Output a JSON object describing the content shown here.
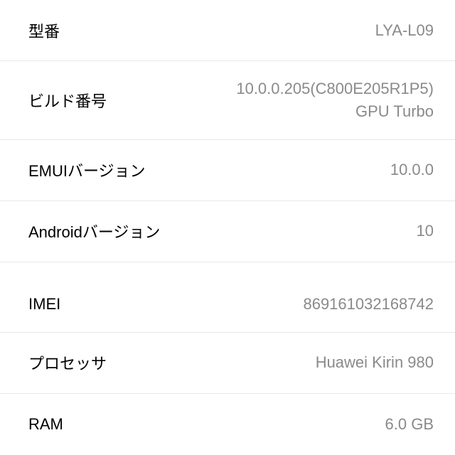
{
  "rows": [
    {
      "label": "型番",
      "value": "LYA-L09"
    },
    {
      "label": "ビルド番号",
      "value": "10.0.0.205(C800E205R1P5)\nGPU Turbo"
    },
    {
      "label": "EMUIバージョン",
      "value": "10.0.0"
    },
    {
      "label": "Androidバージョン",
      "value": "10"
    },
    {
      "label": "IMEI",
      "value": "869161032168742"
    },
    {
      "label": "プロセッサ",
      "value": "Huawei Kirin 980"
    },
    {
      "label": "RAM",
      "value": "6.0 GB"
    }
  ]
}
